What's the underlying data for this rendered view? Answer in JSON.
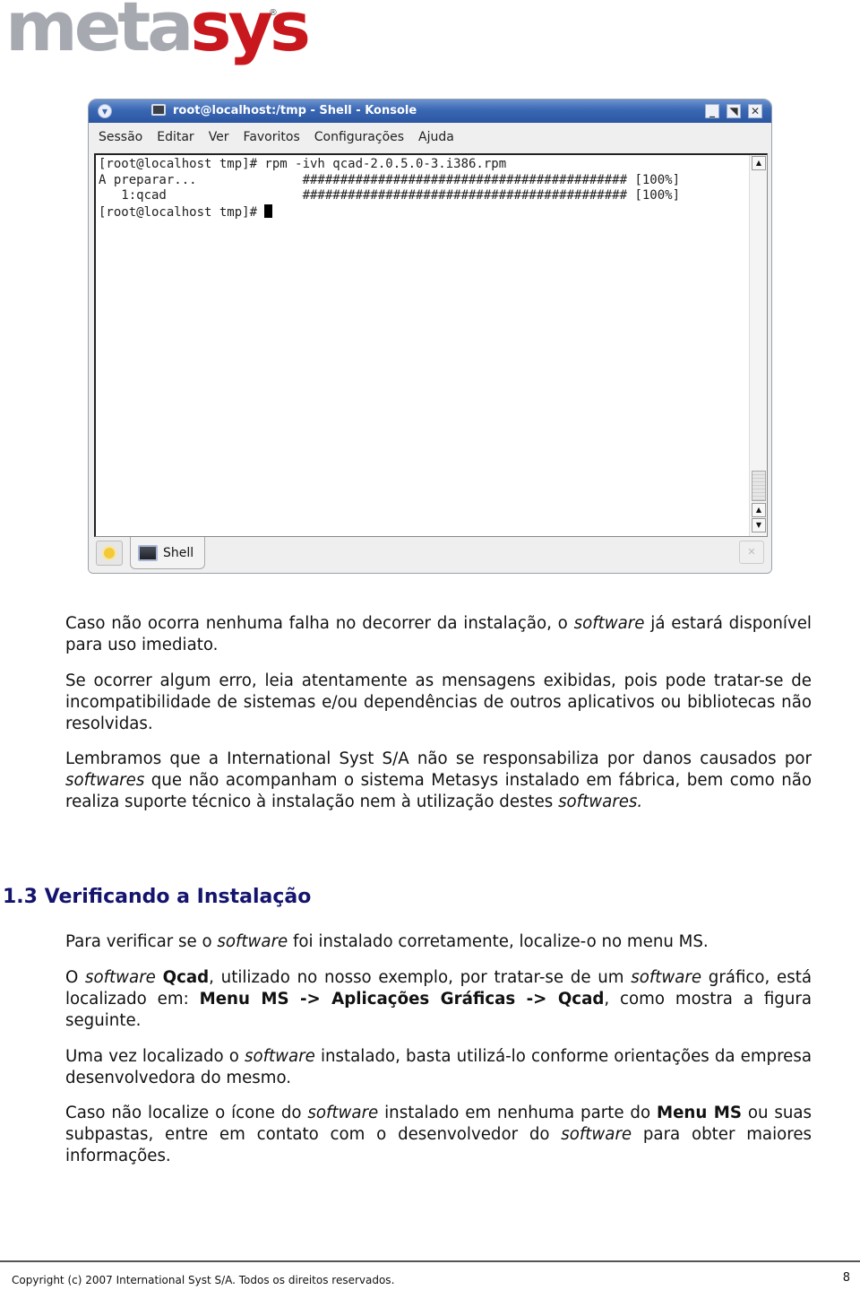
{
  "logo": {
    "part1": "meta",
    "part2": "sys",
    "registered": "®"
  },
  "window": {
    "title": "root@localhost:/tmp - Shell - Konsole",
    "buttons": {
      "minimize": "_",
      "maximize": "◥",
      "close": "✕"
    },
    "menu": [
      "Sessão",
      "Editar",
      "Ver",
      "Favoritos",
      "Configurações",
      "Ajuda"
    ],
    "terminal_lines": [
      "[root@localhost tmp]# rpm -ivh qcad-2.0.5.0-3.i386.rpm",
      "A preparar...              ########################################### [100%]",
      "   1:qcad                  ########################################### [100%]",
      "[root@localhost tmp]# "
    ],
    "scroll": {
      "up": "▲",
      "down": "▼"
    },
    "tabs": [
      {
        "label": "Shell"
      }
    ],
    "tab_close": "ℹ✕"
  },
  "content": {
    "p1": {
      "a": "Caso não ocorra nenhuma falha no decorrer da instalação, o ",
      "em": "software",
      "b": " já estará disponível para uso imediato."
    },
    "p2": "Se ocorrer algum erro,  leia atentamente as mensagens exibidas, pois pode tratar-se de incompatibilidade de sistemas e/ou dependências de outros aplicativos ou bibliotecas não resolvidas.",
    "p3": {
      "a": "Lembramos que a International Syst S/A não se responsabiliza por danos causados por ",
      "em1": "softwares",
      "b": " que não acompanham o sistema Metasys instalado em fábrica, bem como não realiza suporte técnico à instalação nem à utilização destes ",
      "em2": "softwares."
    },
    "heading": "1.3 Verificando a Instalação",
    "p4": {
      "a": "Para verificar se o ",
      "em": "software",
      "b": " foi instalado corretamente, localize-o no menu MS."
    },
    "p5": {
      "a": "O ",
      "em1": "software",
      "b1": " ",
      "strong1": "Qcad",
      "c": ", utilizado no nosso exemplo, por tratar-se de um ",
      "em2": "software",
      "d": " gráfico, está localizado em: ",
      "strong2": "Menu MS -> Aplicações Gráficas -> Qcad",
      "e": ", como mostra a figura seguinte."
    },
    "p6": {
      "a": "Uma vez localizado o ",
      "em": "software",
      "b": " instalado, basta utilizá-lo conforme orientações da empresa desenvolvedora do mesmo."
    },
    "p7": {
      "a": "Caso não localize o ícone do ",
      "em1": "software",
      "b": " instalado em nenhuma parte do ",
      "strong": "Menu MS",
      "c": " ou suas subpastas, entre em contato com o desenvolvedor do ",
      "em2": "software",
      "d": " para obter maiores informações."
    }
  },
  "footer": {
    "copyright": "Copyright (c) 2007 International Syst S/A. Todos os direitos reservados.",
    "page": "8"
  }
}
